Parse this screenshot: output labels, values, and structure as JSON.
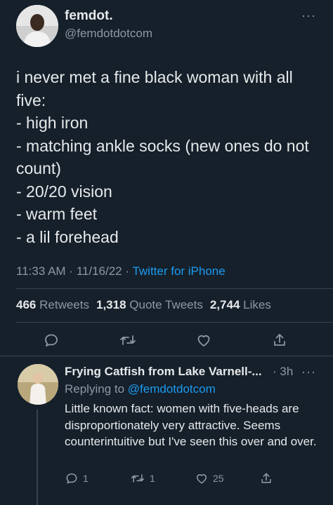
{
  "tweet": {
    "display_name": "femdot.",
    "handle": "@femdotdotcom",
    "more": "···",
    "text": "i never met a fine black woman with all five:\n- high iron\n- matching ankle socks (new ones do not count)\n- 20/20 vision\n- warm feet\n- a lil forehead",
    "time": "11:33 AM",
    "date": "11/16/22",
    "source": "Twitter for iPhone",
    "stats": {
      "retweets_count": "466",
      "retweets_label": "Retweets",
      "quote_count": "1,318",
      "quote_label": "Quote Tweets",
      "likes_count": "2,744",
      "likes_label": "Likes"
    },
    "actions": {
      "reply_icon": "reply-icon",
      "retweet_icon": "retweet-icon",
      "like_icon": "heart-icon",
      "share_icon": "share-icon"
    }
  },
  "reply": {
    "display_name": "Frying Catfish from Lake Varnell-...",
    "time": "3h",
    "more": "···",
    "replying_prefix": "Replying to",
    "replying_handle": "@femdotdotcom",
    "text": "Little known fact: women with five-heads are disproportionately very attractive. Seems counterintuitive but I've seen this over and over.",
    "reply_count": "1",
    "retweet_count": "1",
    "like_count": "25"
  },
  "colors": {
    "background": "#15202b",
    "primary_text": "#e7e9ea",
    "secondary_text": "#8b98a5",
    "accent": "#1d9bf0",
    "divider": "#38444d"
  }
}
